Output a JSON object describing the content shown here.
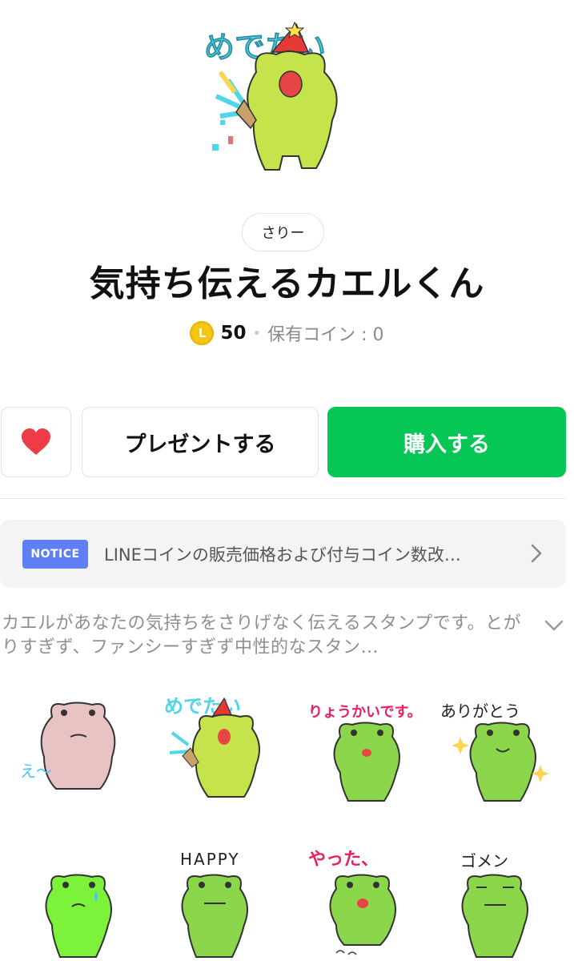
{
  "hero": {
    "caption": "めでたい"
  },
  "author": {
    "name": "さりー"
  },
  "title": "気持ち伝えるカエルくん",
  "price": {
    "coin_symbol": "L",
    "amount": "50",
    "owned_label": "保有コイン : 0"
  },
  "actions": {
    "present_label": "プレゼントする",
    "buy_label": "購入する"
  },
  "notice": {
    "badge": "NOTICE",
    "text": "LINEコインの販売価格および付与コイン数改…"
  },
  "description": "カエルがあなたの気持ちをさりげなく伝えるスタンプです。とがりすぎず、ファンシーすぎず中性的なスタン…",
  "stickers": [
    {
      "caption": "え〜"
    },
    {
      "caption": "めでたい"
    },
    {
      "caption": "りょうかいです。"
    },
    {
      "caption": "ありがとう"
    },
    {
      "caption": ""
    },
    {
      "caption": "HAPPY"
    },
    {
      "caption": "やった、"
    },
    {
      "caption": "ゴメン"
    }
  ],
  "colors": {
    "accent": "#06c755",
    "notice_badge": "#5e7ff5",
    "heart": "#ee3b48",
    "coin": "#f5c518"
  },
  "icons": {
    "favorite": "heart-icon",
    "notice_arrow": "chevron-right-icon",
    "expand": "chevron-down-icon",
    "coin": "line-coin-icon"
  }
}
